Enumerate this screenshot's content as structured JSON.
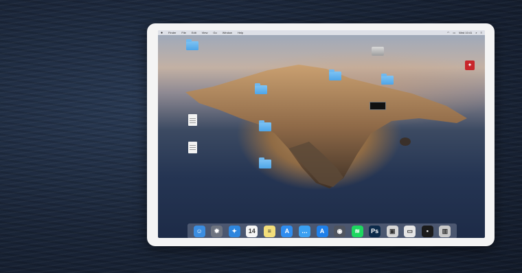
{
  "menubar": {
    "apple": "",
    "items": [
      "Finder",
      "File",
      "Edit",
      "View",
      "Go",
      "Window",
      "Help"
    ],
    "status": [
      "Wed 10:41"
    ]
  },
  "desktop_icons": {
    "folder_1": "",
    "folder_2": "",
    "folder_3": "",
    "folder_4": "",
    "folder_5": "",
    "folder_6": "",
    "doc_1": "",
    "doc_2": "",
    "drive": "",
    "red_app": "",
    "dark_app": ""
  },
  "dock": {
    "items": [
      {
        "name": "finder",
        "glyph": "☺",
        "color": "#3b8de0"
      },
      {
        "name": "launchpad",
        "glyph": "✹",
        "color": "#6e7480"
      },
      {
        "name": "safari",
        "glyph": "✦",
        "color": "#2e86de"
      },
      {
        "name": "calendar",
        "glyph": "14",
        "color": "#f5f5f5"
      },
      {
        "name": "notes",
        "glyph": "≡",
        "color": "#f3de7a"
      },
      {
        "name": "app-store",
        "glyph": "A",
        "color": "#2f8df0"
      },
      {
        "name": "messages",
        "glyph": "…",
        "color": "#3aa0f2"
      },
      {
        "name": "app-store-2",
        "glyph": "A",
        "color": "#1f80ea"
      },
      {
        "name": "screenshot",
        "glyph": "◉",
        "color": "#505560"
      },
      {
        "name": "spotify",
        "glyph": "≋",
        "color": "#1ed760"
      },
      {
        "name": "photoshop",
        "glyph": "Ps",
        "color": "#0c2a4a"
      },
      {
        "name": "preview",
        "glyph": "▣",
        "color": "#d6d6d6"
      },
      {
        "name": "finder-window",
        "glyph": "▭",
        "color": "#e6e6e6"
      },
      {
        "name": "terminal",
        "glyph": "▪",
        "color": "#1b1b1b"
      },
      {
        "name": "trash",
        "glyph": "▥",
        "color": "#c9c9c9"
      }
    ]
  }
}
